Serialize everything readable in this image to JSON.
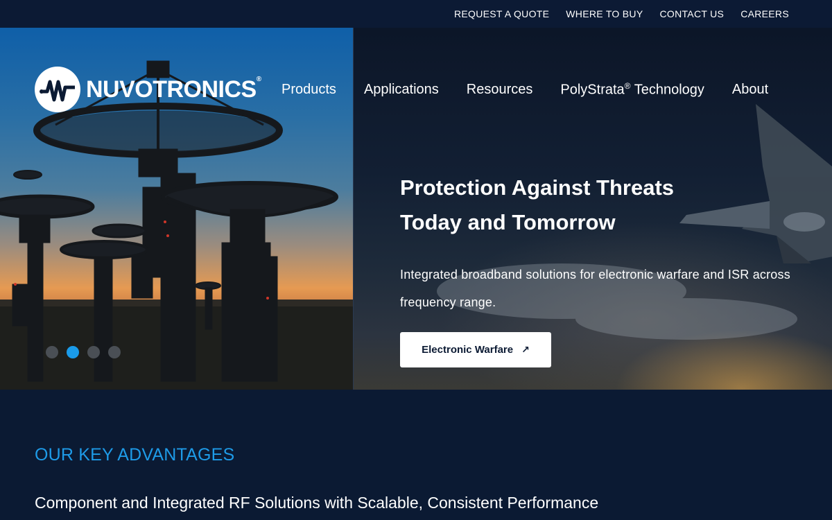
{
  "utility_nav": {
    "items": [
      "REQUEST A QUOTE",
      "WHERE TO BUY",
      "CONTACT US",
      "CAREERS"
    ]
  },
  "logo": {
    "text": "NUVOTRONICS",
    "reg": "®"
  },
  "main_nav": {
    "products": "Products",
    "applications": "Applications",
    "resources": "Resources",
    "polystrata": "PolyStrata",
    "polystrata_reg": "®",
    "polystrata_suffix": " Technology",
    "about": "About"
  },
  "hero": {
    "title_line1": "Protection Against Threats",
    "title_line2": "Today and Tomorrow",
    "description": "Integrated broadband solutions for electronic warfare and ISR across frequency range.",
    "cta_label": "Electronic Warfare",
    "cta_icon": "↗",
    "carousel": {
      "slide_count": 4,
      "active_index": 1
    }
  },
  "advantages": {
    "heading": "OUR KEY ADVANTAGES",
    "subheading": "Component and Integrated RF Solutions with Scalable, Consistent Performance"
  },
  "colors": {
    "background": "#0b1a33",
    "accent": "#1e9be8",
    "dot_active": "#1a9bea",
    "dot_inactive": "#4a4f55"
  }
}
